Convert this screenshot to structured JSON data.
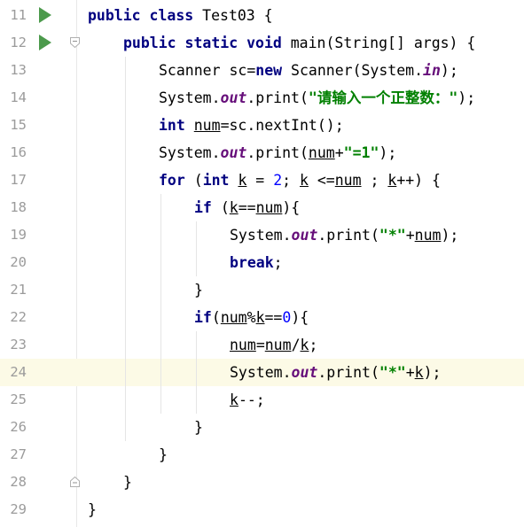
{
  "editor": {
    "current_line": 24,
    "lines": [
      {
        "n": "11",
        "indent": 0,
        "run": true,
        "fold": "",
        "tokens": [
          {
            "t": "public class ",
            "c": "kw"
          },
          {
            "t": "Test03 {",
            "c": ""
          }
        ]
      },
      {
        "n": "12",
        "indent": 1,
        "run": true,
        "fold": "open",
        "tokens": [
          {
            "t": "public static void ",
            "c": "kw"
          },
          {
            "t": "main(String[] args) {",
            "c": ""
          }
        ]
      },
      {
        "n": "13",
        "indent": 2,
        "tokens": [
          {
            "t": "Scanner sc=",
            "c": ""
          },
          {
            "t": "new ",
            "c": "kw"
          },
          {
            "t": "Scanner(System.",
            "c": ""
          },
          {
            "t": "in",
            "c": "field"
          },
          {
            "t": ");",
            "c": ""
          }
        ]
      },
      {
        "n": "14",
        "indent": 2,
        "tokens": [
          {
            "t": "System.",
            "c": ""
          },
          {
            "t": "out",
            "c": "field"
          },
          {
            "t": ".print(",
            "c": ""
          },
          {
            "t": "\"请输入一个正整数：\"",
            "c": "str"
          },
          {
            "t": ");",
            "c": ""
          }
        ]
      },
      {
        "n": "15",
        "indent": 2,
        "tokens": [
          {
            "t": "int ",
            "c": "kw"
          },
          {
            "t": "num",
            "c": "ul"
          },
          {
            "t": "=sc.nextInt();",
            "c": ""
          }
        ]
      },
      {
        "n": "16",
        "indent": 2,
        "tokens": [
          {
            "t": "System.",
            "c": ""
          },
          {
            "t": "out",
            "c": "field"
          },
          {
            "t": ".print(",
            "c": ""
          },
          {
            "t": "num",
            "c": "ul"
          },
          {
            "t": "+",
            "c": ""
          },
          {
            "t": "\"=1\"",
            "c": "str"
          },
          {
            "t": ");",
            "c": ""
          }
        ]
      },
      {
        "n": "17",
        "indent": 2,
        "tokens": [
          {
            "t": "for ",
            "c": "kw"
          },
          {
            "t": "(",
            "c": ""
          },
          {
            "t": "int ",
            "c": "kw"
          },
          {
            "t": "k",
            "c": "ul"
          },
          {
            "t": " = ",
            "c": ""
          },
          {
            "t": "2",
            "c": "num"
          },
          {
            "t": "; ",
            "c": ""
          },
          {
            "t": "k",
            "c": "ul"
          },
          {
            "t": " <=",
            "c": ""
          },
          {
            "t": "num",
            "c": "ul"
          },
          {
            "t": " ; ",
            "c": ""
          },
          {
            "t": "k",
            "c": "ul"
          },
          {
            "t": "++) {",
            "c": ""
          }
        ]
      },
      {
        "n": "18",
        "indent": 3,
        "tokens": [
          {
            "t": "if ",
            "c": "kw"
          },
          {
            "t": "(",
            "c": ""
          },
          {
            "t": "k",
            "c": "ul"
          },
          {
            "t": "==",
            "c": ""
          },
          {
            "t": "num",
            "c": "ul"
          },
          {
            "t": "){",
            "c": ""
          }
        ]
      },
      {
        "n": "19",
        "indent": 4,
        "tokens": [
          {
            "t": "System.",
            "c": ""
          },
          {
            "t": "out",
            "c": "field"
          },
          {
            "t": ".print(",
            "c": ""
          },
          {
            "t": "\"*\"",
            "c": "str"
          },
          {
            "t": "+",
            "c": ""
          },
          {
            "t": "num",
            "c": "ul"
          },
          {
            "t": ");",
            "c": ""
          }
        ]
      },
      {
        "n": "20",
        "indent": 4,
        "tokens": [
          {
            "t": "break",
            "c": "kw"
          },
          {
            "t": ";",
            "c": ""
          }
        ]
      },
      {
        "n": "21",
        "indent": 3,
        "tokens": [
          {
            "t": "}",
            "c": ""
          }
        ]
      },
      {
        "n": "22",
        "indent": 3,
        "tokens": [
          {
            "t": "if",
            "c": "kw"
          },
          {
            "t": "(",
            "c": ""
          },
          {
            "t": "num",
            "c": "ul"
          },
          {
            "t": "%",
            "c": ""
          },
          {
            "t": "k",
            "c": "ul"
          },
          {
            "t": "==",
            "c": ""
          },
          {
            "t": "0",
            "c": "num"
          },
          {
            "t": "){",
            "c": ""
          }
        ]
      },
      {
        "n": "23",
        "indent": 4,
        "tokens": [
          {
            "t": "num",
            "c": "ul"
          },
          {
            "t": "=",
            "c": ""
          },
          {
            "t": "num",
            "c": "ul"
          },
          {
            "t": "/",
            "c": ""
          },
          {
            "t": "k",
            "c": "ul"
          },
          {
            "t": ";",
            "c": ""
          }
        ]
      },
      {
        "n": "24",
        "indent": 4,
        "tokens": [
          {
            "t": "System.",
            "c": ""
          },
          {
            "t": "out",
            "c": "field"
          },
          {
            "t": ".print(",
            "c": ""
          },
          {
            "t": "\"*\"",
            "c": "str"
          },
          {
            "t": "+",
            "c": ""
          },
          {
            "t": "k",
            "c": "ul"
          },
          {
            "t": ");",
            "c": ""
          }
        ]
      },
      {
        "n": "25",
        "indent": 4,
        "tokens": [
          {
            "t": "k",
            "c": "ul"
          },
          {
            "t": "--;",
            "c": ""
          }
        ]
      },
      {
        "n": "26",
        "indent": 3,
        "tokens": [
          {
            "t": "}",
            "c": ""
          }
        ]
      },
      {
        "n": "27",
        "indent": 2,
        "tokens": [
          {
            "t": "}",
            "c": ""
          }
        ]
      },
      {
        "n": "28",
        "indent": 1,
        "fold": "close",
        "tokens": [
          {
            "t": "}",
            "c": ""
          }
        ]
      },
      {
        "n": "29",
        "indent": 0,
        "tokens": [
          {
            "t": "}",
            "c": ""
          }
        ]
      }
    ]
  },
  "colors": {
    "keyword": "#000080",
    "field": "#660e7a",
    "string": "#008000",
    "number": "#0000ff",
    "line_number": "#9b9b9b",
    "current_line_bg": "#fcfae6",
    "run_icon": "#4c9a4c"
  },
  "icons": {
    "run": "run-arrow-icon",
    "fold_open": "fold-open-icon",
    "fold_close": "fold-close-icon"
  }
}
